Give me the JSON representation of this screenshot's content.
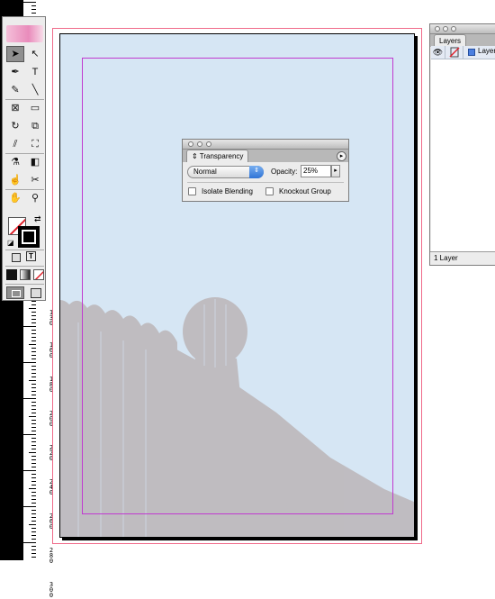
{
  "ruler": {
    "labels": [
      "1 3 0",
      "1 6 0",
      "1 8 0",
      "2 0 0",
      "2 2 0",
      "2 4 0",
      "2 6 0",
      "2 8 0",
      "3 0 0"
    ]
  },
  "tools_panel": {
    "tools": [
      {
        "name": "selection-tool-icon",
        "glyph": "➤",
        "selected": true
      },
      {
        "name": "direct-selection-tool-icon",
        "glyph": "↖",
        "selected": false
      },
      {
        "name": "pen-tool-icon",
        "glyph": "✒",
        "selected": false
      },
      {
        "name": "type-tool-icon",
        "glyph": "T",
        "selected": false
      },
      {
        "name": "pencil-tool-icon",
        "glyph": "✎",
        "selected": false
      },
      {
        "name": "line-tool-icon",
        "glyph": "╲",
        "selected": false
      },
      {
        "name": "rectangle-frame-tool-icon",
        "glyph": "⊠",
        "selected": false
      },
      {
        "name": "rectangle-tool-icon",
        "glyph": "▭",
        "selected": false
      },
      {
        "name": "rotate-tool-icon",
        "glyph": "↻",
        "selected": false
      },
      {
        "name": "scale-tool-icon",
        "glyph": "⧉",
        "selected": false
      },
      {
        "name": "shear-tool-icon",
        "glyph": "⫽",
        "selected": false
      },
      {
        "name": "free-transform-tool-icon",
        "glyph": "⛶",
        "selected": false
      },
      {
        "name": "eyedropper-tool-icon",
        "glyph": "⚗",
        "selected": false
      },
      {
        "name": "gradient-tool-icon",
        "glyph": "◧",
        "selected": false
      },
      {
        "name": "button-tool-icon",
        "glyph": "☝",
        "selected": false
      },
      {
        "name": "scissors-tool-icon",
        "glyph": "✂",
        "selected": false
      },
      {
        "name": "hand-tool-icon",
        "glyph": "✋",
        "selected": false
      },
      {
        "name": "zoom-tool-icon",
        "glyph": "⚲",
        "selected": false
      }
    ],
    "format_text_glyph": "T"
  },
  "transparency_panel": {
    "tab_label": "Transparency",
    "blend_mode": "Normal",
    "opacity_label": "Opacity:",
    "opacity_value": "25%",
    "isolate_label": "Isolate Blending",
    "knockout_label": "Knockout Group",
    "isolate_checked": false,
    "knockout_checked": false
  },
  "layers_panel": {
    "tab_label": "Layers",
    "layer_name": "Layer",
    "status": "1 Layer"
  },
  "colors": {
    "page_background": "#d6e6f4",
    "bleed_guide": "#f06a8a",
    "margin_guide": "#c03ad0",
    "sculpture": "#a48a82",
    "layer_color": "#4b7fe0"
  }
}
